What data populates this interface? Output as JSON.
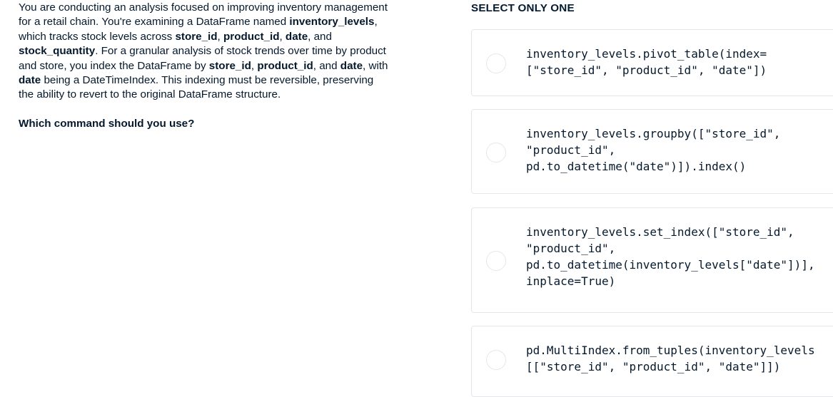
{
  "question": {
    "segments": [
      {
        "t": "You are conducting an analysis focused on improving inventory management for a retail chain. You're examining a DataFrame named ",
        "b": false
      },
      {
        "t": "inventory_levels",
        "b": true
      },
      {
        "t": ", which tracks stock levels across ",
        "b": false
      },
      {
        "t": "store_id",
        "b": true
      },
      {
        "t": ", ",
        "b": false
      },
      {
        "t": "product_id",
        "b": true
      },
      {
        "t": ", ",
        "b": false
      },
      {
        "t": "date",
        "b": true
      },
      {
        "t": ", and ",
        "b": false
      },
      {
        "t": "stock_quantity",
        "b": true
      },
      {
        "t": ". For a granular analysis of stock trends over time by product and store, you index the DataFrame by ",
        "b": false
      },
      {
        "t": "store_id",
        "b": true
      },
      {
        "t": ", ",
        "b": false
      },
      {
        "t": "product_id",
        "b": true
      },
      {
        "t": ", and ",
        "b": false
      },
      {
        "t": "date",
        "b": true
      },
      {
        "t": ", with ",
        "b": false
      },
      {
        "t": "date",
        "b": true
      },
      {
        "t": " being a DateTimeIndex. This indexing must be reversible, preserving the ability to revert to the original DataFrame structure.",
        "b": false
      }
    ],
    "ask": "Which command should you use?"
  },
  "select_label": "SELECT ONLY ONE",
  "options": [
    {
      "code": "inventory_levels.pivot_table(index=\n[\"store_id\", \"product_id\", \"date\"])"
    },
    {
      "code": "inventory_levels.groupby([\"store_id\",\n\"product_id\",\npd.to_datetime(\"date\")]).index()"
    },
    {
      "code": "inventory_levels.set_index([\"store_id\",\n\"product_id\",\npd.to_datetime(inventory_levels[\"date\"])],\ninplace=True)"
    },
    {
      "code": "pd.MultiIndex.from_tuples(inventory_levels\n[[\"store_id\", \"product_id\", \"date\"]])"
    }
  ]
}
